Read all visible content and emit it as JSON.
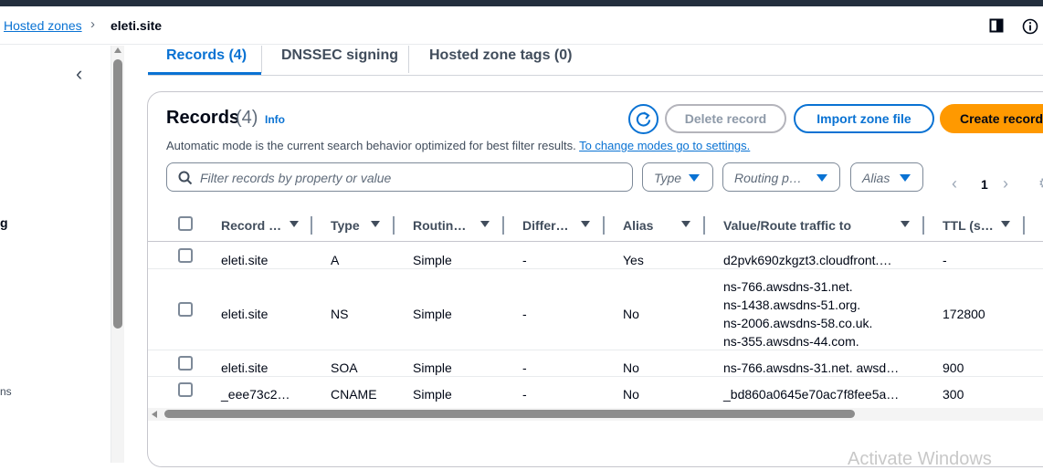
{
  "breadcrumb": {
    "parent": "Hosted zones",
    "separator": "›",
    "current": "eleti.site"
  },
  "tabs": [
    {
      "label": "Records (4)",
      "active": true
    },
    {
      "label": "DNSSEC signing",
      "active": false
    },
    {
      "label": "Hosted zone tags (0)",
      "active": false
    }
  ],
  "left_nav": {
    "fragment1": "g",
    "fragment2": "ns"
  },
  "records": {
    "title": "Records",
    "count": "(4)",
    "info": "Info",
    "buttons": {
      "delete": "Delete record",
      "import": "Import zone file",
      "create": "Create record"
    },
    "description": "Automatic mode is the current search behavior optimized for best filter results.",
    "description_link": "To change modes go to settings.",
    "search_placeholder": "Filter records by property or value",
    "filters": {
      "type": "Type",
      "routing": "Routing p…",
      "alias": "Alias"
    },
    "pager": {
      "current": "1"
    },
    "columns": [
      "Record …",
      "Type",
      "Routin…",
      "Differ…",
      "Alias",
      "Value/Route traffic to",
      "TTL (s…"
    ],
    "rows": [
      {
        "name": "eleti.site",
        "type": "A",
        "routing": "Simple",
        "diff": "-",
        "alias": "Yes",
        "values": [
          "d2pvk690zkgzt3.cloudfront.…"
        ],
        "ttl": "-"
      },
      {
        "name": "eleti.site",
        "type": "NS",
        "routing": "Simple",
        "diff": "-",
        "alias": "No",
        "values": [
          "ns-766.awsdns-31.net.",
          "ns-1438.awsdns-51.org.",
          "ns-2006.awsdns-58.co.uk.",
          "ns-355.awsdns-44.com."
        ],
        "ttl": "172800"
      },
      {
        "name": "eleti.site",
        "type": "SOA",
        "routing": "Simple",
        "diff": "-",
        "alias": "No",
        "values": [
          "ns-766.awsdns-31.net. awsd…"
        ],
        "ttl": "900"
      },
      {
        "name": "_eee73c2…",
        "type": "CNAME",
        "routing": "Simple",
        "diff": "-",
        "alias": "No",
        "values": [
          "_bd860a0645e70ac7f8fee5a…"
        ],
        "ttl": "300"
      }
    ]
  },
  "watermark": "Activate Windows",
  "colors": {
    "accent": "#0972d3",
    "primary_button": "#ff9900",
    "topbar": "#232f3e"
  }
}
